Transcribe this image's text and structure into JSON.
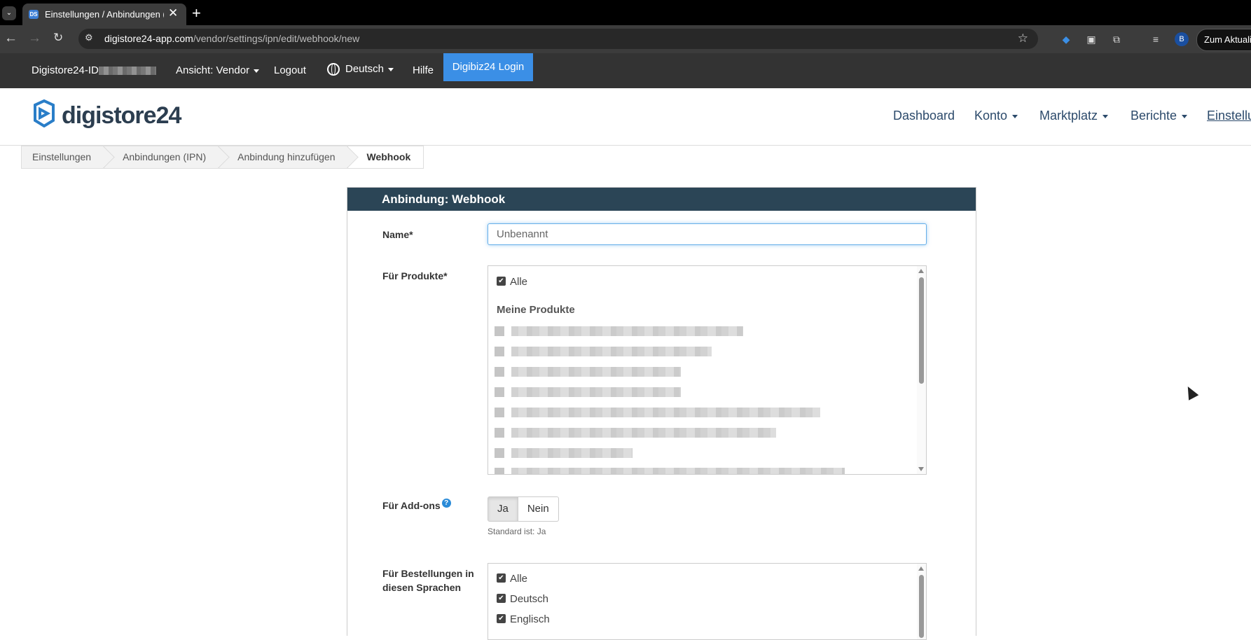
{
  "browser": {
    "tab_title": "Einstellungen / Anbindungen (I",
    "tab_favicon": "DS",
    "url_host": "digistore24-app.com",
    "url_path": "/vendor/settings/ipn/edit/webhook/new",
    "profile_initial": "B",
    "update_button": "Zum Aktualis"
  },
  "utilbar": {
    "account_id_prefix": "Digistore24-ID",
    "view_label": "Ansicht: Vendor",
    "logout": "Logout",
    "language": "Deutsch",
    "help": "Hilfe",
    "digibiz_login": "Digibiz24 Login",
    "digibiz_color": "#3b8fe6"
  },
  "header": {
    "logo_text": "digistore24",
    "nav": [
      "Dashboard",
      "Konto",
      "Marktplatz",
      "Berichte",
      "Einstellu"
    ]
  },
  "breadcrumb": [
    "Einstellungen",
    "Anbindungen (IPN)",
    "Anbindung hinzufügen",
    "Webhook"
  ],
  "panel": {
    "title": "Anbindung: Webhook",
    "header_color": "#2b4556",
    "name_label": "Name*",
    "name_placeholder": "Unbenannt",
    "products_label": "Für Produkte*",
    "products_all": "Alle",
    "products_group": "Meine Produkte",
    "addons_label": "Für Add-ons",
    "addons_help": "?",
    "addons_yes": "Ja",
    "addons_no": "Nein",
    "addons_hint": "Standard ist: Ja",
    "languages_label_1": "Für Bestellungen in",
    "languages_label_2": "diesen Sprachen",
    "languages": [
      "Alle",
      "Deutsch",
      "Englisch"
    ]
  }
}
